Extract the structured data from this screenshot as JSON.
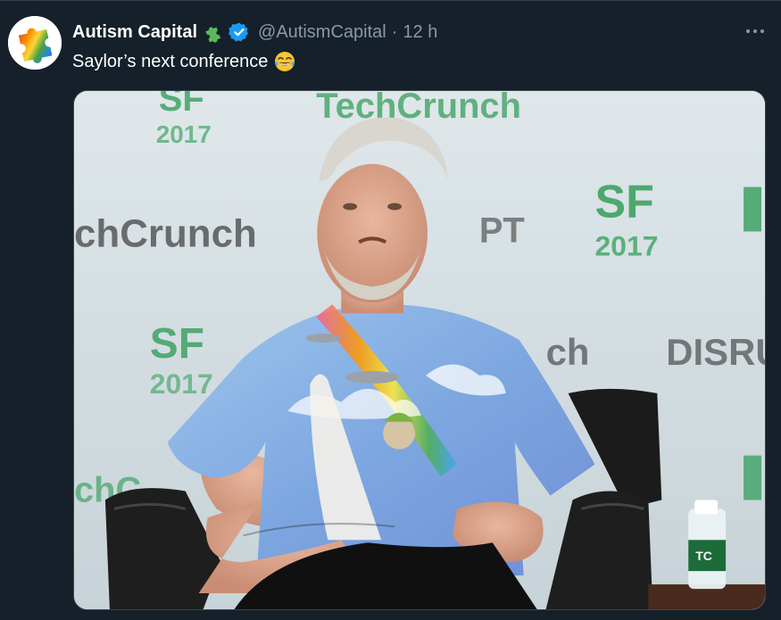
{
  "tweet": {
    "display_name": "Autism Capital",
    "handle": "@AutismCapital",
    "separator": "·",
    "time": "12 h",
    "text": "Saylor’s next conference"
  },
  "icons": {
    "avatar": "rainbow-puzzle-piece",
    "name_badge": "green-puzzle-piece",
    "verified": "verified-check",
    "emoji": "face-with-tears-of-joy",
    "more": "more-horizontal"
  },
  "media": {
    "backdrop_texts": [
      "SF",
      "2017",
      "TechCrunch",
      "chCrunch",
      "SF",
      "2017",
      "SF",
      "2017",
      "DISRU",
      "ch",
      "PT",
      "chC"
    ],
    "bottle_label": "TC"
  },
  "colors": {
    "background": "#15202b",
    "text": "#ffffff",
    "muted": "#8899a6",
    "verified": "#1d9bf0",
    "badge_green": "#5cb85c",
    "tc_green": "#2a9a52",
    "divider": "#38444d"
  }
}
